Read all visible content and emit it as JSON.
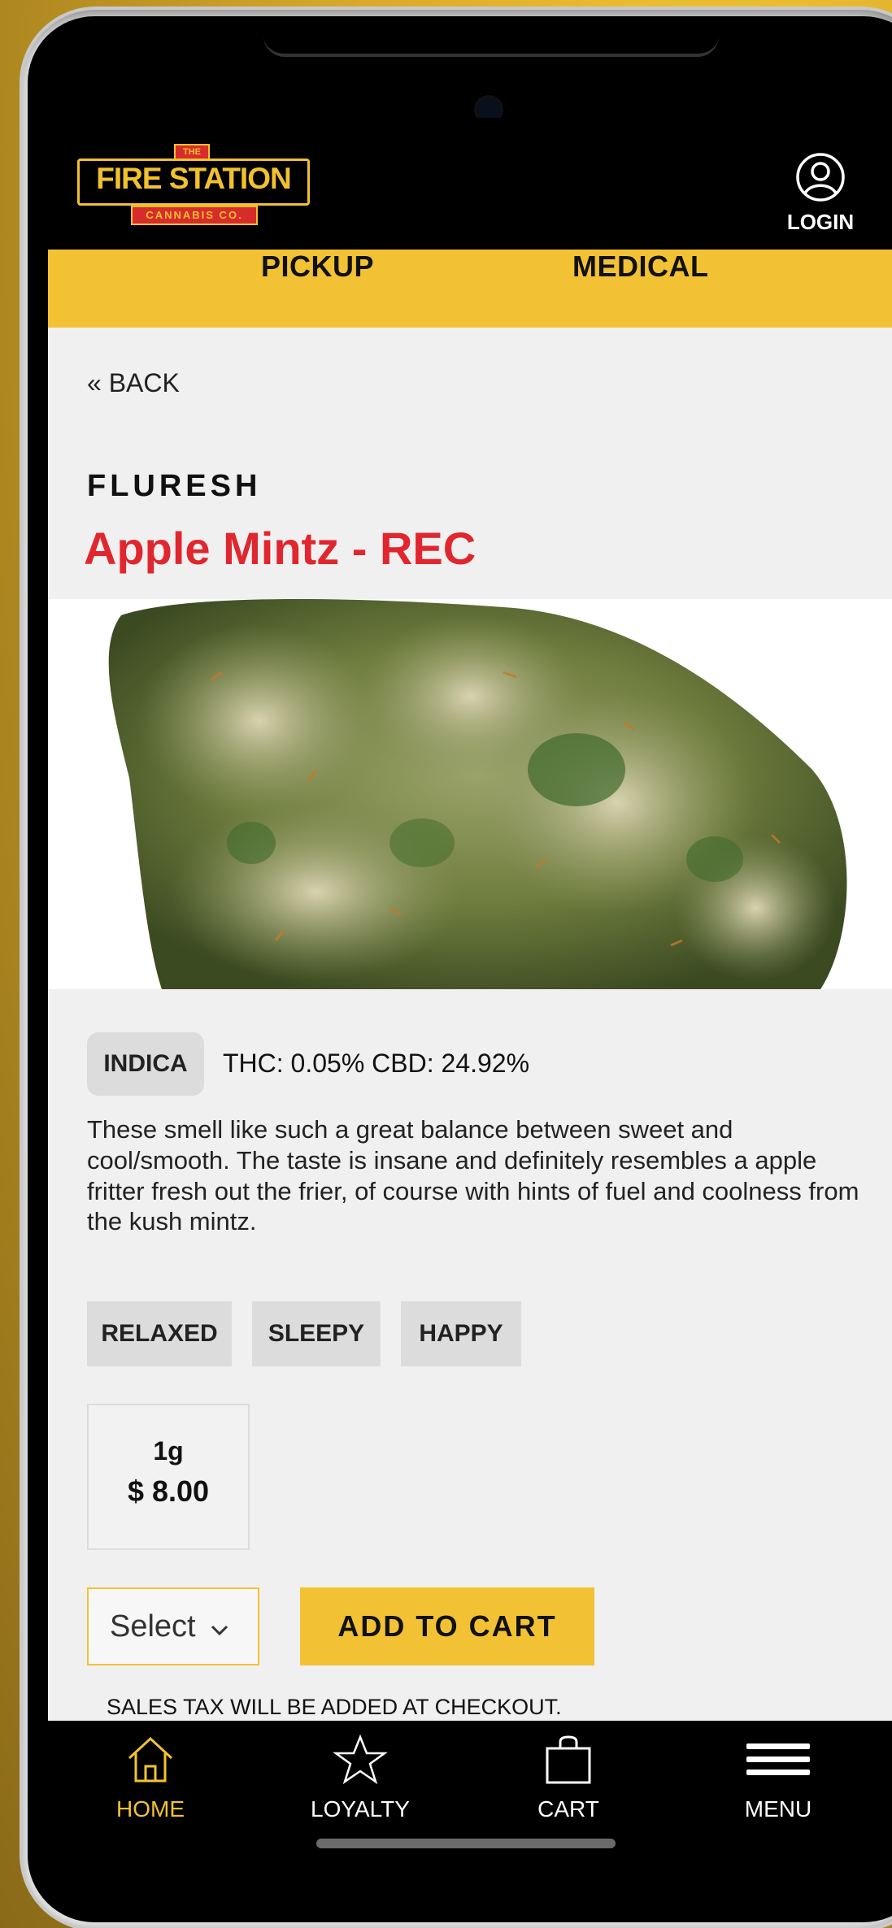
{
  "header": {
    "logo": {
      "top": "THE",
      "main": "FIRE STATION",
      "sub": "CANNABIS CO."
    },
    "login_label": "LOGIN"
  },
  "tabs": [
    {
      "label": "PICKUP"
    },
    {
      "label": "MEDICAL"
    }
  ],
  "back_label": "« BACK",
  "product": {
    "brand": "FLURESH",
    "name": "Apple Mintz - REC",
    "type": "INDICA",
    "potency": "THC: 0.05%  CBD: 24.92%",
    "description": "These smell like such a great balance between sweet and cool/smooth. The taste is insane and definitely resembles a apple fritter fresh out the frier, of course with hints of fuel and coolness from the kush mintz.",
    "effects": [
      "RELAXED",
      "SLEEPY",
      "HAPPY"
    ],
    "size": {
      "weight": "1g",
      "price": "$ 8.00"
    }
  },
  "purchase": {
    "select_label": "Select",
    "add_to_cart_label": "ADD TO CART",
    "tax_note": "SALES TAX WILL BE ADDED AT CHECKOUT."
  },
  "bottom_nav": [
    {
      "label": "HOME",
      "icon": "home-icon",
      "active": true
    },
    {
      "label": "LOYALTY",
      "icon": "star-icon"
    },
    {
      "label": "CART",
      "icon": "shopping-bag-icon"
    },
    {
      "label": "MENU",
      "icon": "hamburger-menu-icon"
    }
  ],
  "colors": {
    "accent": "#f3c234",
    "brand_red": "#e0262e",
    "background": "#f0f0f0",
    "nav_bg": "#000000"
  }
}
